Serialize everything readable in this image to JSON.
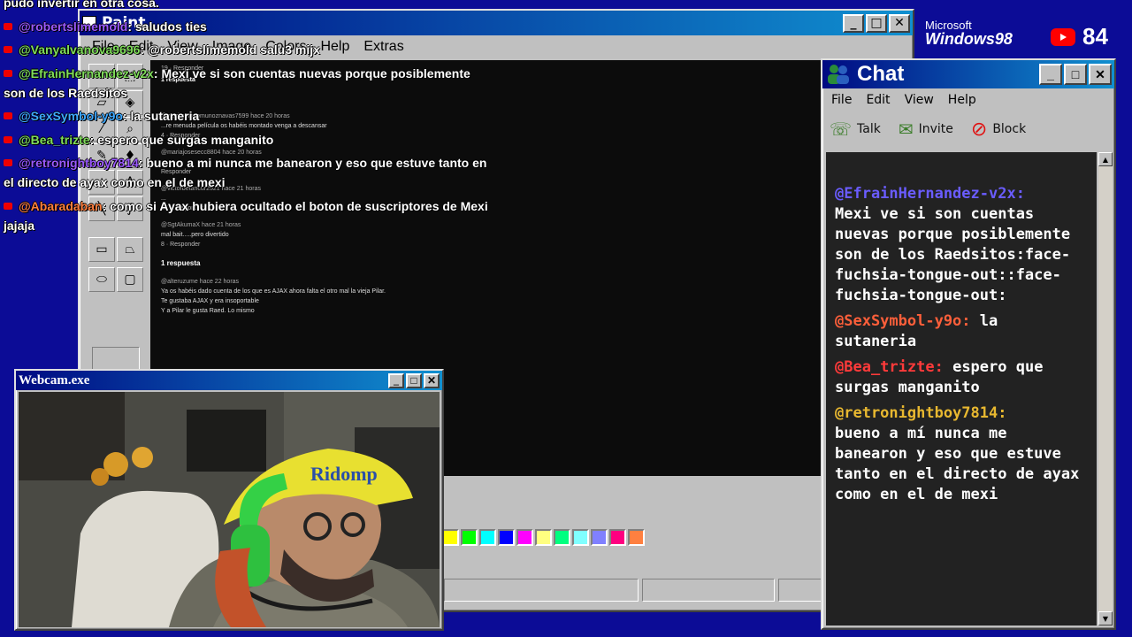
{
  "paint": {
    "title": "Paint",
    "menu": [
      "File",
      "Edit",
      "View",
      "Image",
      "Colors",
      "Help",
      "Extras"
    ]
  },
  "canvas_comments": [
    {
      "user": "",
      "time": "",
      "text": "",
      "actions": "19 · Responder"
    },
    {
      "user": "@maricarmenmunoznavas7599",
      "time": "hace 20 horas",
      "text": "...re menuda película os habéis montado venga a descansar",
      "actions": "4 · Responder"
    },
    {
      "user": "@mariajosesecc8804",
      "time": "hace 20 horas",
      "text": "...",
      "actions": "Responder"
    },
    {
      "user": "@victorbetancur2521",
      "time": "hace 21 horas",
      "text": "...",
      "actions": "16 · Responder"
    },
    {
      "user": "@SgtAkumaX",
      "time": "hace 21 horas",
      "text": "mal bait.....pero divertido",
      "actions": "8 · Responder"
    },
    {
      "user": "@alteruzume",
      "time": "hace 22 horas",
      "text": "Ya os habéis dado cuenta de los que es AJAX ahora falta el otro mal la vieja Pilar.\nTe gustaba AJAX y era insoportable\nY a Pilar le gusta Raed. Lo mismo",
      "actions": ""
    }
  ],
  "canvas_reply_toggle": "1 respuesta",
  "canvas_reply_indicator": "1 respuesta",
  "chat_overlay": [
    {
      "user": "",
      "text": "pudo invertir en otra cosa.",
      "user_color": "#7fdc5a"
    },
    {
      "user": "@robertslimemold",
      "text": ": saludos ties",
      "user_color": "#9b59ff"
    },
    {
      "user": "@Vanyalvanova9696",
      "text": ": @robertslimemold salu3 mijx",
      "user_color": "#7fdc5a"
    },
    {
      "user": "@EfrainHernandez-v2x",
      "text": ": Mexi ve si son cuentas nuevas porque posiblemente son de los Raedsitos",
      "user_color": "#7fdc5a"
    },
    {
      "user": "@SexSymbol-y9o",
      "text": ": la sutaneria",
      "user_color": "#3fa9ff"
    },
    {
      "user": "@Bea_trizte",
      "text": ": espero que surgas manganito",
      "user_color": "#7fdc5a"
    },
    {
      "user": "@retronightboy7814",
      "text": ": bueno a mi nunca me banearon y eso que estuve tanto en el directo de ayax como en el de mexi",
      "user_color": "#9b59ff"
    },
    {
      "user": "@Abaradaban",
      "text": ": como si Ayax hubiera ocultado el boton de suscriptores de Mexi jajaja",
      "user_color": "#ff7f3f"
    }
  ],
  "webcam": {
    "title": "Webcam.exe",
    "cap_text": "Ridomp"
  },
  "chat": {
    "title": "Chat",
    "menu": [
      "File",
      "Edit",
      "View",
      "Help"
    ],
    "tools": {
      "talk": "Talk",
      "invite": "Invite",
      "block": "Block"
    },
    "messages": [
      {
        "user": "@EfrainHernandez-v2x:",
        "text": "Mexi ve si son cuentas nuevas porque posiblemente son de los Raedsitos:face-fuchsia-tongue-out::face-fuchsia-tongue-out:",
        "color": "#6a5cff"
      },
      {
        "user": "@SexSymbol-y9o:",
        "text": "la sutaneria",
        "color": "#ff5f3a"
      },
      {
        "user": "@Bea_trizte:",
        "text": "espero que surgas manganito",
        "color": "#ff3a3a"
      },
      {
        "user": "@retronightboy7814:",
        "text": "bueno a mí nunca me banearon y eso que estuve tanto en el directo de ayax como en el de mexi",
        "color": "#e8b830"
      }
    ]
  },
  "overlay": {
    "ms_line1": "Microsoft",
    "ms_line2": "Windows98",
    "viewer_count": "84"
  },
  "palette_colors": [
    "#ffff00",
    "#00ff00",
    "#00ffff",
    "#0000ff",
    "#ff00ff",
    "#ffff80",
    "#00ff80",
    "#80ffff",
    "#8080ff",
    "#ff0080",
    "#ff8040"
  ]
}
